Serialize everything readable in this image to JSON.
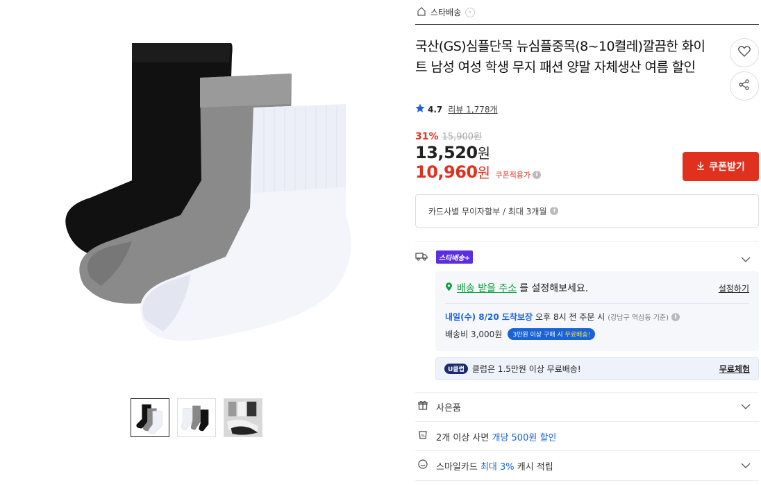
{
  "seller": {
    "name": "스타배송"
  },
  "product": {
    "title": "국산(GS)심플단목 뉴심플중목(8~10켤레)깔끔한 화이트 남성 여성 학생 무지 패션 양말 자체생산 여름 할인",
    "rating": "4.7",
    "review_label": "리뷰",
    "review_count": "1,778개",
    "discount_rate": "31%",
    "original_price": "15,900원",
    "price_number": "13,520",
    "price_unit": "원",
    "coupon_price_number": "10,960",
    "coupon_price_unit": "원",
    "coupon_note": "쿠폰적용가"
  },
  "actions": {
    "coupon_button": "쿠폰받기"
  },
  "card_info": "카드사별 무이자할부 / 최대 3개월",
  "shipping": {
    "badge": "스타배송+",
    "address_link": "배송 받을 주소",
    "address_rest": "를 설정해보세요.",
    "set_link": "설정하기",
    "arrival_date": "내일(수) 8/20 도착보장",
    "arrival_cond": "오후 8시 전 주문 시",
    "arrival_basis": "(강남구 역삼동 기준)",
    "fee": "배송비 3,000원",
    "free_pill_prefix": "3만원 이상 구매 시",
    "free_pill_highlight": "무료배송!"
  },
  "uclub": {
    "badge": "U클럽",
    "text": "클럽은 1.5만원 이상 무료배송!",
    "trial": "무료체험"
  },
  "options": {
    "gift": "사은품",
    "multi_prefix": "2개 이상 사면",
    "multi_highlight": "개당 500원 할인",
    "smile_prefix": "스마일카드",
    "smile_highlight": "최대 3%",
    "smile_suffix": "캐시 적립"
  },
  "colors": {
    "accent_red": "#e0301e",
    "accent_blue": "#1a63d6",
    "badge_purple": "#5b2ee0",
    "link_green": "#0a9f3c"
  }
}
